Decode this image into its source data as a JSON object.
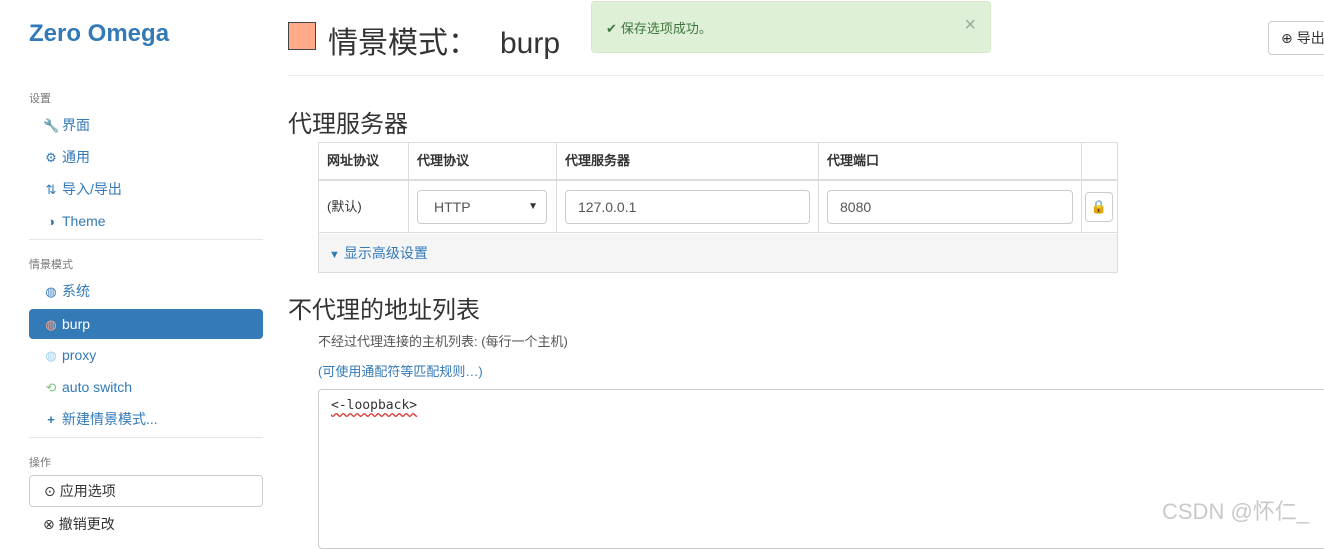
{
  "sidebar": {
    "brand": "Zero Omega",
    "settings_header": "设置",
    "settings_items": [
      {
        "label": "界面",
        "icon": "wrench-icon"
      },
      {
        "label": "通用",
        "icon": "gear-icon"
      },
      {
        "label": "导入/导出",
        "icon": "import-export-icon"
      },
      {
        "label": "Theme",
        "icon": "half-circle-icon"
      }
    ],
    "profiles_header": "情景模式",
    "profile_items": [
      {
        "label": "系统",
        "icon": "globe-icon"
      },
      {
        "label": "burp",
        "icon": "globe-icon"
      },
      {
        "label": "proxy",
        "icon": "globe-icon"
      },
      {
        "label": "auto switch",
        "icon": "switch-arrows-icon"
      },
      {
        "label": "新建情景模式...",
        "icon": "plus-icon"
      }
    ],
    "actions_header": "操作",
    "apply_label": "应用选项",
    "discard_label": "撤销更改"
  },
  "header": {
    "title_prefix": "情景模式：",
    "profile_name": "burp",
    "profile_color": "#ffaa88",
    "export_label": "导出"
  },
  "alert": {
    "message": "保存选项成功。",
    "close": "×"
  },
  "proxy_section": {
    "title": "代理服务器",
    "columns": [
      "网址协议",
      "代理协议",
      "代理服务器",
      "代理端口"
    ],
    "row": {
      "scheme": "(默认)",
      "protocol": "HTTP",
      "server": "127.0.0.1",
      "port": "8080"
    },
    "advanced_label": "显示高级设置"
  },
  "bypass_section": {
    "title": "不代理的地址列表",
    "help_text": "不经过代理连接的主机列表: (每行一个主机)",
    "wildcard_link": "(可使用通配符等匹配规则…)",
    "textarea_value": "<-loopback>"
  },
  "watermark": "CSDN @怀仁_",
  "colors": {
    "accent": "#337ab7",
    "success_bg": "#dff0d8",
    "success_text": "#3c763d"
  }
}
